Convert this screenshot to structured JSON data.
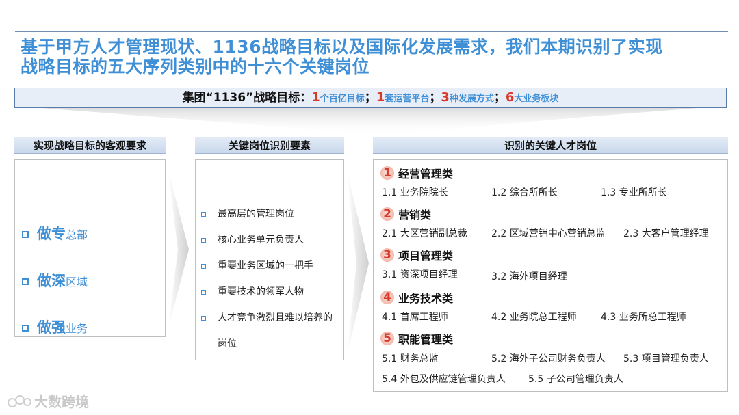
{
  "title": {
    "line1": "基于甲方人才管理现状、1136战略目标以及国际化发展需求，我们本期识别了实现",
    "line2": "战略目标的五大序列类别中的十六个关键岗位"
  },
  "goal": {
    "prefix": "集团“1136”战略目标：",
    "items": [
      {
        "num": "1",
        "unit": "个百亿目标",
        "sep": "；"
      },
      {
        "num": "1",
        "unit": "套运营平台",
        "sep": "；"
      },
      {
        "num": "3",
        "unit": "种发展方式",
        "sep": "；"
      },
      {
        "num": "6",
        "unit": "大业务板块",
        "sep": ""
      }
    ]
  },
  "requirements": {
    "header": "实现战略目标的客观要求",
    "items": [
      {
        "main": "做专",
        "sub": "总部"
      },
      {
        "main": "做深",
        "sub": "区域"
      },
      {
        "main": "做强",
        "sub": "业务"
      }
    ]
  },
  "elements": {
    "header": "关键岗位识别要素",
    "items": [
      "最高层的管理岗位",
      "核心业务单元负责人",
      "重要业务区域的一把手",
      "重要技术的领军人物",
      "人才竞争激烈且难以培养的岗位"
    ]
  },
  "positions": {
    "header": "识别的关键人才岗位",
    "categories": [
      {
        "num": "1",
        "name": "经营管理类",
        "items": [
          "1.1 业务院院长",
          "1.2 综合所所长",
          "1.3 专业所所长"
        ]
      },
      {
        "num": "2",
        "name": "营销类",
        "items": [
          "2.1 大区营销副总裁",
          "2.2 区域营销中心营销总监",
          "2.3 大客户管理经理"
        ]
      },
      {
        "num": "3",
        "name": "项目管理类",
        "items": [
          "3.1 资深项目经理",
          "3.2 海外项目经理"
        ]
      },
      {
        "num": "4",
        "name": "业务技术类",
        "items": [
          "4.1 首席工程师",
          "4.2 业务院总工程师",
          "4.3 业务所总工程师"
        ]
      },
      {
        "num": "5",
        "name": "职能管理类",
        "items": [
          "5.1 财务总监",
          "5.2 海外子公司财务负责人",
          "5.3 项目管理负责人",
          "5.4 外包及供应链管理负责人",
          "5.5 子公司管理负责人"
        ]
      }
    ]
  },
  "watermark": "大数跨境",
  "colors": {
    "accent": "#3f8fd6",
    "number": "#d8392b",
    "border": "#5a7ca8"
  }
}
